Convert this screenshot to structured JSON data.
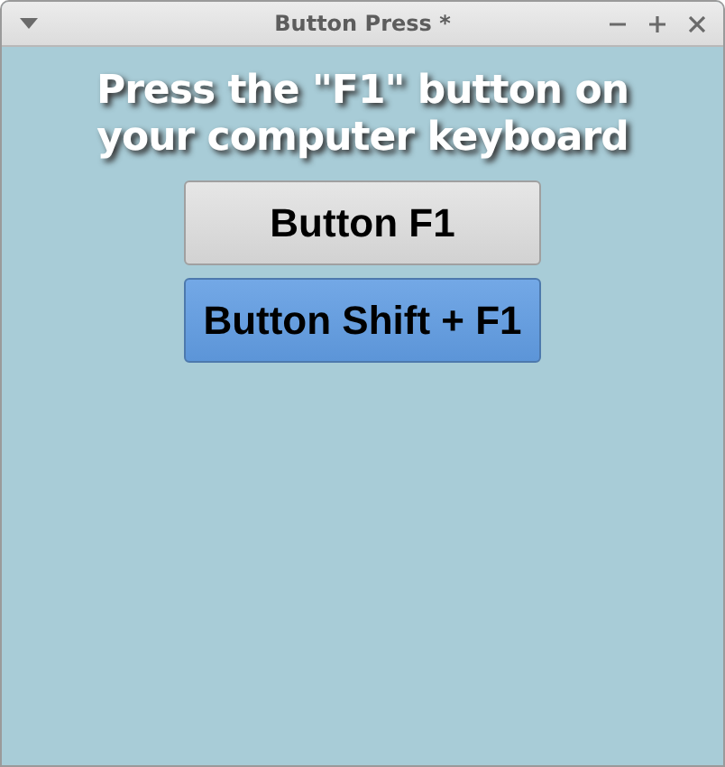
{
  "window": {
    "title": "Button Press *"
  },
  "heading": "Press the \"F1\" button on your computer keyboard",
  "buttons": [
    {
      "label": "Button F1",
      "selected": false
    },
    {
      "label": "Button Shift + F1",
      "selected": true
    }
  ]
}
